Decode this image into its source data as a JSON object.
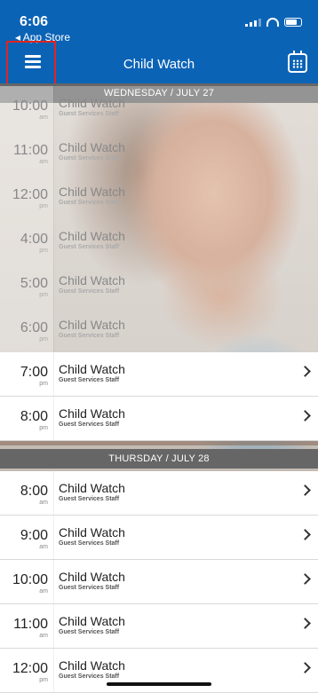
{
  "status_bar": {
    "time": "6:06",
    "back_label": "◂ App Store"
  },
  "header": {
    "title": "Child Watch"
  },
  "days": [
    {
      "label": "WEDNESDAY / JULY 27",
      "sessions": [
        {
          "hour": "10:00",
          "ampm": "am",
          "name": "Child Watch",
          "staff": "Guest Services Staff",
          "state": "past"
        },
        {
          "hour": "11:00",
          "ampm": "am",
          "name": "Child Watch",
          "staff": "Guest Services Staff",
          "state": "past"
        },
        {
          "hour": "12:00",
          "ampm": "pm",
          "name": "Child Watch",
          "staff": "Guest Services Staff",
          "state": "past"
        },
        {
          "hour": "4:00",
          "ampm": "pm",
          "name": "Child Watch",
          "staff": "Guest Services Staff",
          "state": "past"
        },
        {
          "hour": "5:00",
          "ampm": "pm",
          "name": "Child Watch",
          "staff": "Guest Services Staff",
          "state": "past"
        },
        {
          "hour": "6:00",
          "ampm": "pm",
          "name": "Child Watch",
          "staff": "Guest Services Staff",
          "state": "past"
        },
        {
          "hour": "7:00",
          "ampm": "pm",
          "name": "Child Watch",
          "staff": "Guest Services Staff",
          "state": "active"
        },
        {
          "hour": "8:00",
          "ampm": "pm",
          "name": "Child Watch",
          "staff": "Guest Services Staff",
          "state": "active"
        }
      ]
    },
    {
      "label": "THURSDAY / JULY 28",
      "sessions": [
        {
          "hour": "8:00",
          "ampm": "am",
          "name": "Child Watch",
          "staff": "Guest Services Staff",
          "state": "active"
        },
        {
          "hour": "9:00",
          "ampm": "am",
          "name": "Child Watch",
          "staff": "Guest Services Staff",
          "state": "active"
        },
        {
          "hour": "10:00",
          "ampm": "am",
          "name": "Child Watch",
          "staff": "Guest Services Staff",
          "state": "active"
        },
        {
          "hour": "11:00",
          "ampm": "am",
          "name": "Child Watch",
          "staff": "Guest Services Staff",
          "state": "active"
        },
        {
          "hour": "12:00",
          "ampm": "pm",
          "name": "Child Watch",
          "staff": "Guest Services Staff",
          "state": "active"
        }
      ]
    }
  ],
  "colors": {
    "brand_blue": "#0b63b6",
    "date_header": "#666666",
    "highlight_box": "#e0251f"
  }
}
